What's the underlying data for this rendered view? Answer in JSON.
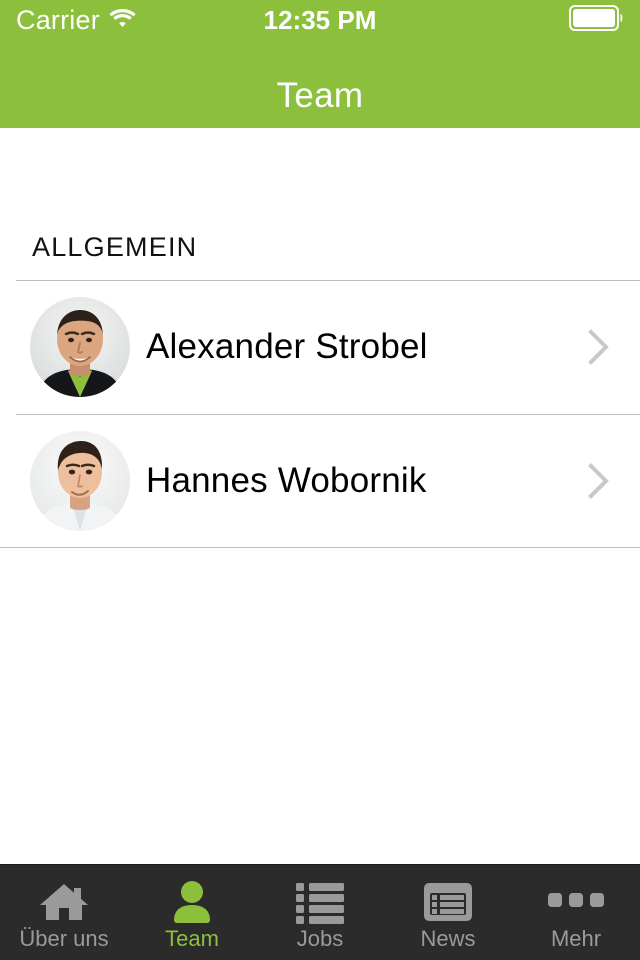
{
  "status_bar": {
    "carrier": "Carrier",
    "wifi_icon": "wifi-icon",
    "time": "12:35 PM",
    "battery_icon": "battery-full-icon"
  },
  "nav_bar": {
    "title": "Team",
    "background_color": "#8CC03C",
    "title_color": "#FFFFFF"
  },
  "content": {
    "section_header": "ALLGEMEIN",
    "rows": [
      {
        "name": "Alexander Strobel",
        "avatar": "portrait-man-dark-jacket-green-shirt",
        "accessory_icon": "chevron-right-icon"
      },
      {
        "name": "Hannes Wobornik",
        "avatar": "portrait-man-white-shirt",
        "accessory_icon": "chevron-right-icon"
      }
    ]
  },
  "tab_bar": {
    "background_color": "#2B2B2B",
    "active_color": "#8CC03C",
    "inactive_color": "#9A9A9A",
    "tabs": [
      {
        "label": "Über uns",
        "icon": "home-icon",
        "active": false
      },
      {
        "label": "Team",
        "icon": "person-icon",
        "active": true
      },
      {
        "label": "Jobs",
        "icon": "bulleted-list-icon",
        "active": false
      },
      {
        "label": "News",
        "icon": "news-panel-icon",
        "active": false
      },
      {
        "label": "Mehr",
        "icon": "ellipsis-icon",
        "active": false
      }
    ]
  }
}
